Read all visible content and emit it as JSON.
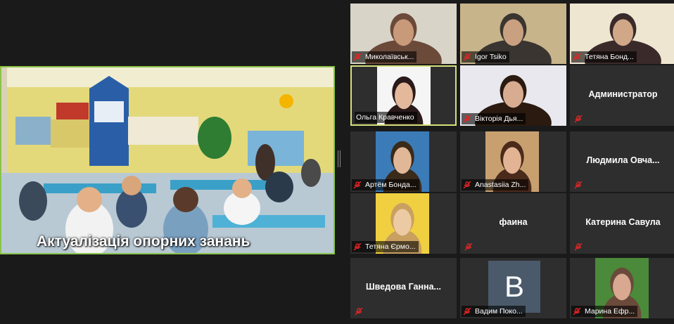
{
  "main_video": {
    "caption": "Актуалізація опорних занань"
  },
  "participants": [
    {
      "name": "Миколаївськ...",
      "type": "video"
    },
    {
      "name": "Igor Tsiko",
      "type": "video"
    },
    {
      "name": "Тетяна Бонд...",
      "type": "video"
    },
    {
      "name": "Ольга Кравченко",
      "type": "video",
      "active": true
    },
    {
      "name": "Вікторія Дья...",
      "type": "video"
    },
    {
      "name": "Администратор",
      "type": "name-only"
    },
    {
      "name": "Артём Бонда...",
      "type": "video"
    },
    {
      "name": "Anastasiia Zh...",
      "type": "video"
    },
    {
      "name": "Людмила Овча...",
      "type": "name-only"
    },
    {
      "name": "Тетяна Єрмо...",
      "type": "video"
    },
    {
      "name": "фаина",
      "type": "name-only"
    },
    {
      "name": "Катерина Савула",
      "type": "name-only"
    },
    {
      "name": "Шведова Ганна...",
      "type": "name-only"
    },
    {
      "name": "Вадим Поко...",
      "type": "avatar",
      "initial": "B"
    },
    {
      "name": "Марина Ефр...",
      "type": "video"
    }
  ],
  "icons": {
    "muted": "mic-muted-icon"
  },
  "colors": {
    "background": "#1a1a1a",
    "tile": "#2e2e2e",
    "active_speaker_border": "#8bc34a",
    "muted_icon": "#e02424"
  }
}
